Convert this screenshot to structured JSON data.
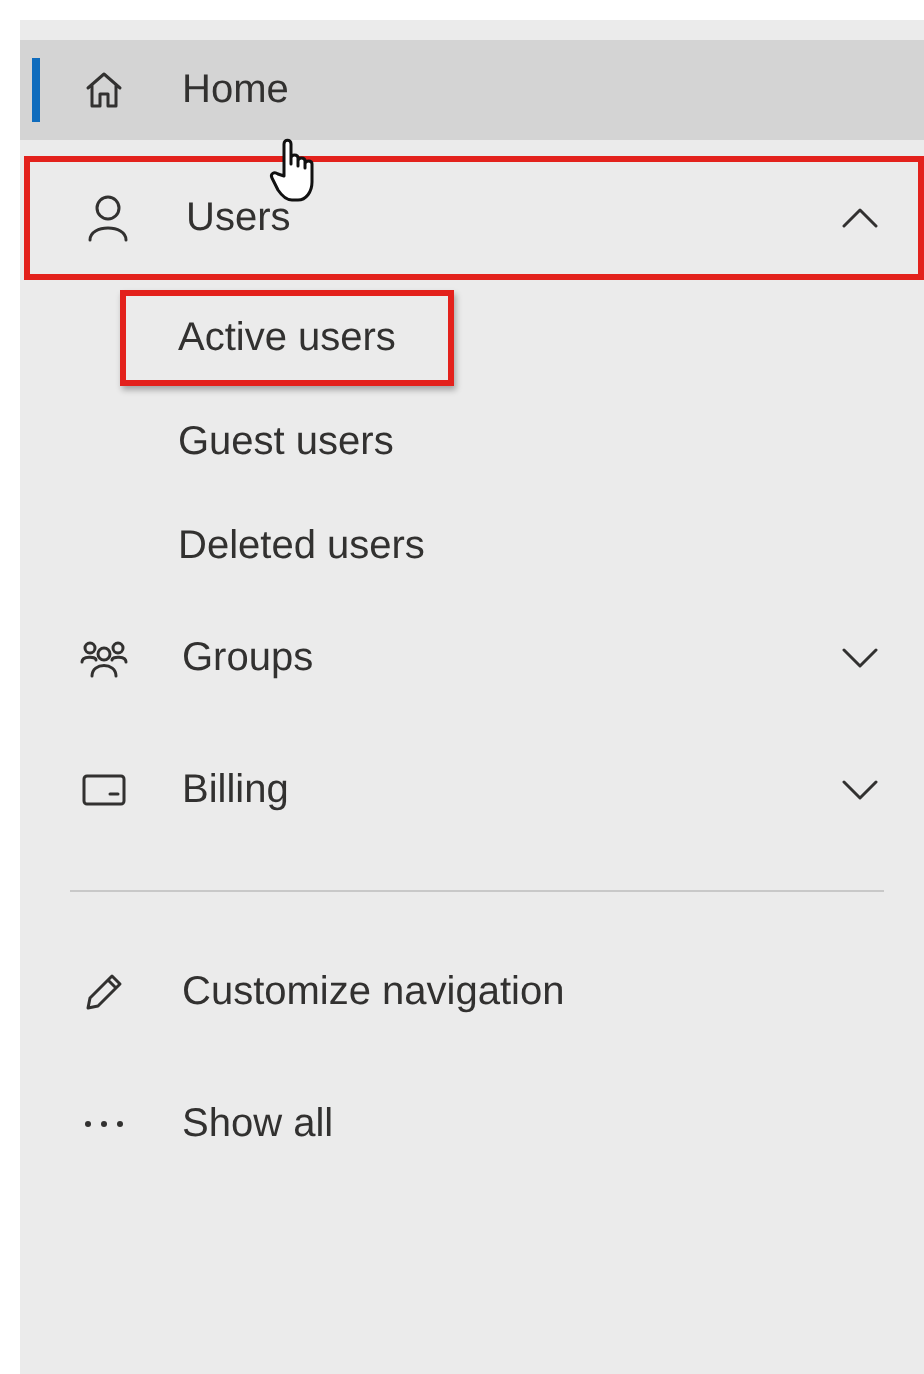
{
  "nav": {
    "items": [
      {
        "label": "Home",
        "selected": true,
        "annotated": false
      },
      {
        "label": "Users",
        "selected": false,
        "annotated": true,
        "expanded": true,
        "children": [
          {
            "label": "Active users",
            "annotated": true
          },
          {
            "label": "Guest users",
            "annotated": false
          },
          {
            "label": "Deleted users",
            "annotated": false
          }
        ]
      },
      {
        "label": "Groups",
        "selected": false,
        "annotated": false,
        "expanded": false
      },
      {
        "label": "Billing",
        "selected": false,
        "annotated": false,
        "expanded": false
      }
    ]
  },
  "actions": [
    {
      "label": "Customize navigation"
    },
    {
      "label": "Show all"
    }
  ]
}
